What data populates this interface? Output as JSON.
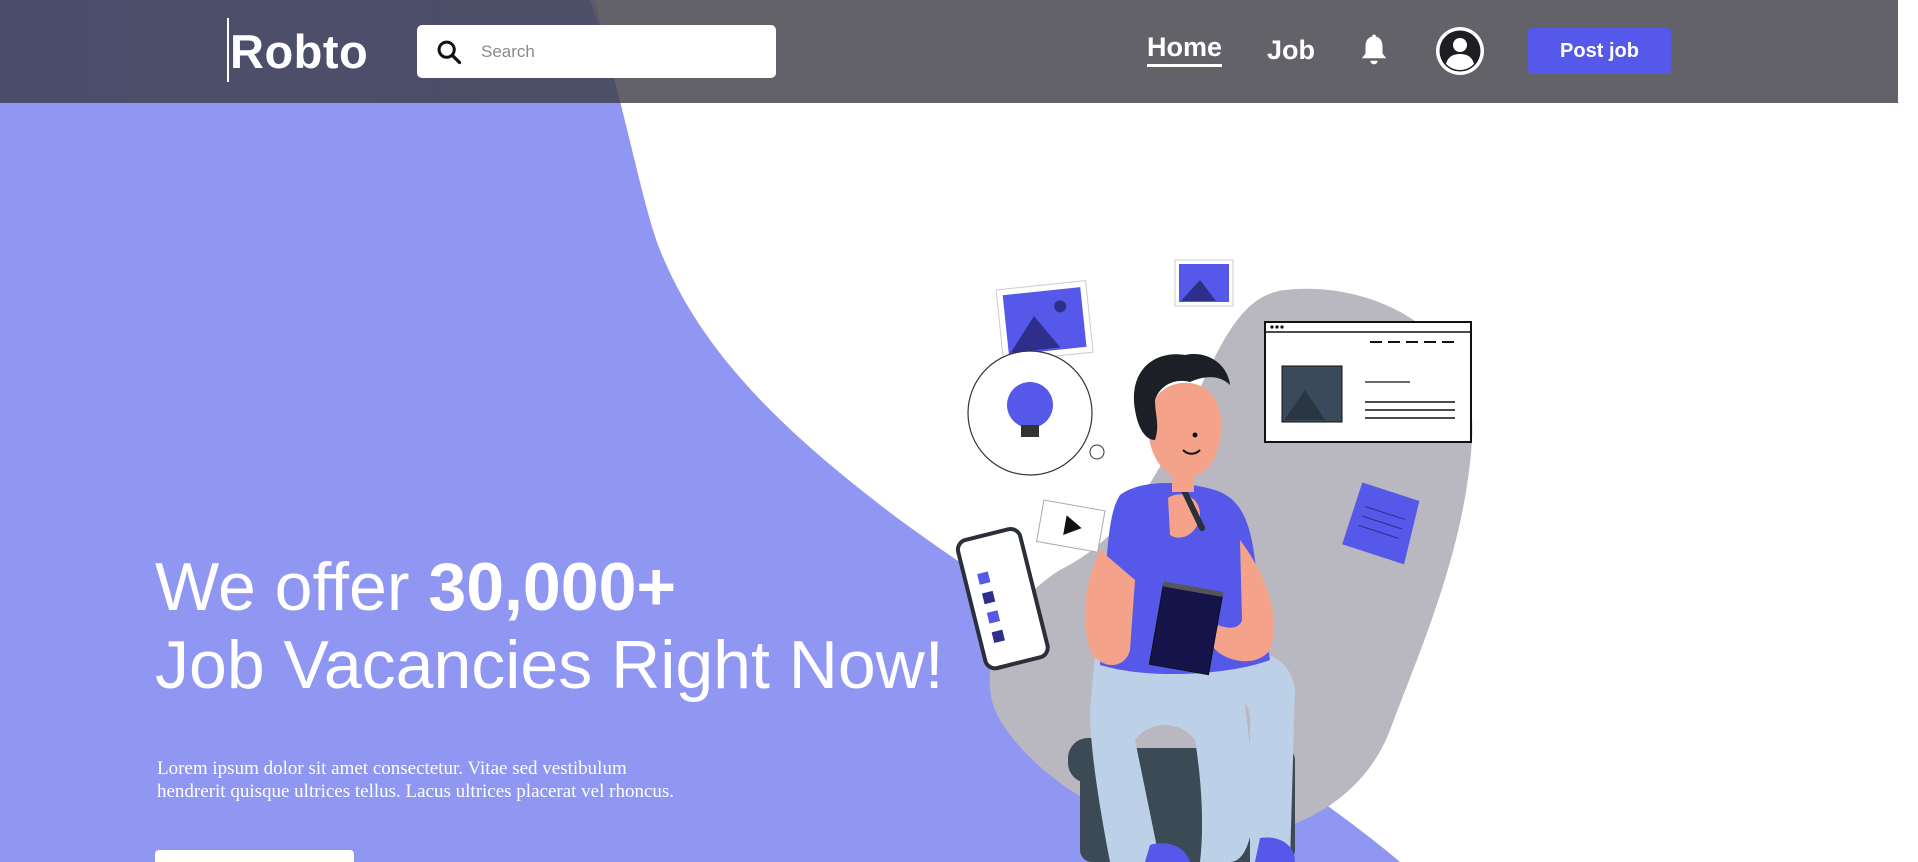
{
  "header": {
    "logo": "Robto",
    "search_placeholder": "Search",
    "nav": {
      "home": "Home",
      "job": "Job"
    },
    "post_job_label": "Post job",
    "icons": [
      "search-icon",
      "bell-icon",
      "user-avatar-icon"
    ]
  },
  "hero": {
    "headline_prefix": "We offer ",
    "headline_number": "30,000+",
    "headline_line2": "Job Vacancies Right Now!",
    "description_line1": "Lorem ipsum dolor sit amet consectetur. Vitae sed vestibulum",
    "description_line2": "hendrerit quisque ultrices tellus. Lacus ultrices placerat vel rhoncus.",
    "cta_label": ""
  },
  "colors": {
    "accent": "#5558e8",
    "hero_purple": "#9097f2",
    "navbar": "#5e5e66",
    "white": "#ffffff"
  }
}
